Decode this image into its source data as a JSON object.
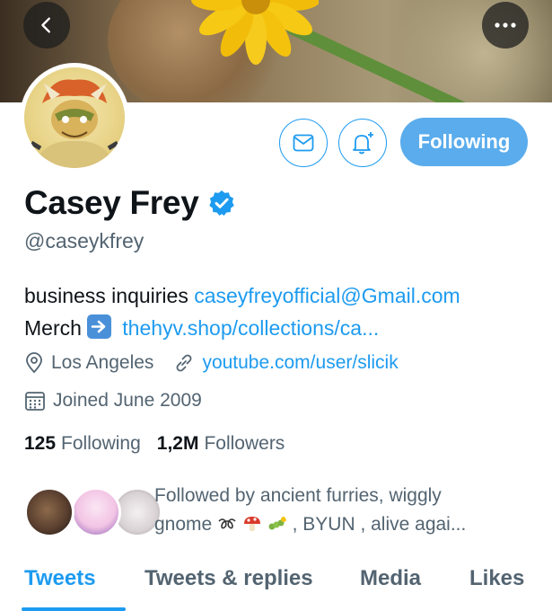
{
  "profile": {
    "name": "Casey Frey",
    "handle": "@caseykfrey",
    "following_button": "Following"
  },
  "bio": {
    "line1_text": "business inquiries",
    "line1_link": "caseyfreyofficial@Gmail.com",
    "line2_text": "Merch",
    "line2_link": "thehyv.shop/collections/ca..."
  },
  "meta": {
    "location": "Los Angeles",
    "website": "youtube.com/user/slicik",
    "joined": "Joined June 2009"
  },
  "stats": {
    "following_count": "125",
    "following_label": "Following",
    "followers_count": "1,2M",
    "followers_label": "Followers"
  },
  "followed_by": {
    "line1": "Followed by ancient furries, wiggly",
    "line2_start": "gnome",
    "line2_end": ", BYUN , alive agai..."
  },
  "tabs": [
    {
      "label": "Tweets",
      "active": true
    },
    {
      "label": "Tweets & replies",
      "active": false
    },
    {
      "label": "Media",
      "active": false
    },
    {
      "label": "Likes",
      "active": false
    }
  ],
  "icons": {
    "back": "chevron-left-icon",
    "more": "more-horizontal-icon",
    "mail": "envelope-icon",
    "bell": "bell-plus-icon",
    "verified": "verified-badge-icon",
    "location": "location-pin-icon",
    "link": "link-icon",
    "calendar": "calendar-icon"
  },
  "colors": {
    "accent": "#1d9bf0",
    "following_button": "#5aacec",
    "secondary_text": "#536471"
  }
}
